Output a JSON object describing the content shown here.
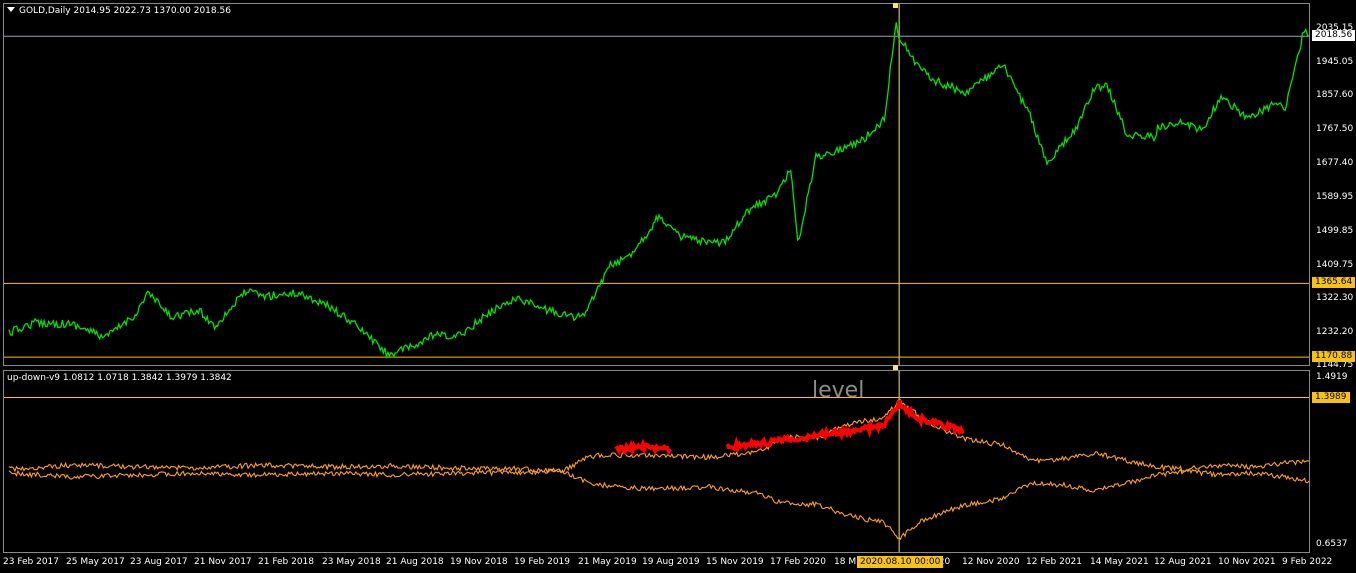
{
  "chart_data": [
    {
      "type": "line",
      "title": "GOLD,Daily  2014.95 2022.73 1370.00 2018.56",
      "symbol": "GOLD",
      "timeframe": "Daily",
      "ohlc": {
        "open": 2014.95,
        "high": 2022.73,
        "low": 1370.0,
        "close": 2018.56
      },
      "y_ticks": [
        "2035.15",
        "1945.05",
        "1857.60",
        "1767.50",
        "1677.40",
        "1589.95",
        "1499.85",
        "1409.75",
        "1322.30",
        "1232.20",
        "1144.75"
      ],
      "ylim": [
        1144.75,
        2035.15
      ],
      "x_ticks": [
        "23 Feb 2017",
        "25 May 2017",
        "23 Aug 2017",
        "21 Nov 2017",
        "21 Feb 2018",
        "23 May 2018",
        "21 Aug 2018",
        "19 Nov 2018",
        "19 Feb 2019",
        "21 May 2019",
        "19 Aug 2019",
        "15 Nov 2019",
        "17 Feb 2020",
        "18 M",
        "2020.08.10 00:00",
        "020",
        "12 Nov 2020",
        "12 Feb 2021",
        "14 May 2021",
        "12 Aug 2021",
        "10 Nov 2021",
        "9 Feb 2022"
      ],
      "horizontal_lines": [
        {
          "value": 2018.56,
          "label": "2018.56",
          "color": "#9aa0b8"
        },
        {
          "value": 1365.64,
          "label": "1365.64",
          "color": "#f7c30f"
        },
        {
          "value": 1170.88,
          "label": "1170.88",
          "color": "#f7c30f"
        }
      ],
      "crosshair_time": "2020.08.10 00:00",
      "series": [
        {
          "color": "#00e400",
          "x": [
            "2017-02-23",
            "2017-04-01",
            "2017-05-25",
            "2017-07-10",
            "2017-08-23",
            "2017-09-08",
            "2017-10-10",
            "2017-11-21",
            "2017-12-12",
            "2018-01-25",
            "2018-02-21",
            "2018-04-11",
            "2018-05-23",
            "2018-07-01",
            "2018-08-15",
            "2018-09-20",
            "2018-10-20",
            "2018-11-19",
            "2019-01-01",
            "2019-01-31",
            "2019-02-19",
            "2019-03-20",
            "2019-05-02",
            "2019-05-21",
            "2019-06-25",
            "2019-07-20",
            "2019-08-19",
            "2019-09-04",
            "2019-10-01",
            "2019-11-15",
            "2019-12-05",
            "2020-01-08",
            "2020-02-17",
            "2020-03-09",
            "2020-03-19",
            "2020-04-14",
            "2020-05-18",
            "2020-06-20",
            "2020-07-20",
            "2020-08-06",
            "2020-08-10",
            "2020-09-01",
            "2020-10-01",
            "2020-11-12",
            "2021-01-05",
            "2021-02-12",
            "2021-03-08",
            "2021-04-20",
            "2021-05-14",
            "2021-06-01",
            "2021-06-29",
            "2021-08-09",
            "2021-08-12",
            "2021-09-20",
            "2021-10-15",
            "2021-11-10",
            "2021-11-16",
            "2021-12-20",
            "2022-01-25",
            "2022-02-09",
            "2022-03-01",
            "2022-03-08",
            "2022-03-15"
          ],
          "y": [
            1235,
            1262,
            1258,
            1222,
            1286,
            1342,
            1278,
            1292,
            1252,
            1345,
            1332,
            1340,
            1305,
            1255,
            1178,
            1198,
            1230,
            1222,
            1280,
            1318,
            1325,
            1300,
            1278,
            1280,
            1410,
            1432,
            1500,
            1545,
            1492,
            1470,
            1475,
            1558,
            1600,
            1670,
            1470,
            1700,
            1720,
            1745,
            1800,
            2060,
            2020,
            1950,
            1900,
            1870,
            1940,
            1810,
            1680,
            1780,
            1880,
            1890,
            1760,
            1750,
            1780,
            1790,
            1770,
            1860,
            1850,
            1800,
            1840,
            1830,
            1980,
            2035,
            2018
          ]
        }
      ]
    },
    {
      "type": "line",
      "title": "up-down-v9 1.0812 1.0718 1.3842 1.3979 1.3842",
      "indicator": "up-down-v9",
      "values_text": "1.0812 1.0718 1.3842 1.3979 1.3842",
      "y_ticks": [
        "1.4919",
        "0.6537"
      ],
      "ylim": [
        0.6537,
        1.4919
      ],
      "horizontal_lines": [
        {
          "value": 1.3989,
          "label": "1.3989",
          "color": "#f7c30f"
        }
      ],
      "annotation": "level",
      "series": [
        {
          "color": "#ffa01e",
          "x": [
            "2017-02-23",
            "2017-05-25",
            "2017-08-23",
            "2017-11-21",
            "2018-02-21",
            "2018-05-23",
            "2018-08-21",
            "2018-11-19",
            "2019-02-19",
            "2019-04-20",
            "2019-05-21",
            "2019-06-10",
            "2019-08-19",
            "2019-11-15",
            "2020-01-20",
            "2020-02-17",
            "2020-03-09",
            "2020-04-20",
            "2020-05-18",
            "2020-06-20",
            "2020-07-20",
            "2020-08-10",
            "2020-09-10",
            "2020-10-10",
            "2020-11-12",
            "2021-01-05",
            "2021-02-12",
            "2021-04-01",
            "2021-05-14",
            "2021-07-01",
            "2021-08-12",
            "2021-09-20",
            "2021-11-10",
            "2021-12-20",
            "2022-02-09",
            "2022-03-15"
          ],
          "y": [
            1.04,
            1.06,
            1.05,
            1.045,
            1.06,
            1.05,
            1.055,
            1.045,
            1.04,
            1.03,
            1.09,
            1.11,
            1.11,
            1.1,
            1.12,
            1.17,
            1.2,
            1.2,
            1.25,
            1.28,
            1.3,
            1.38,
            1.3,
            1.24,
            1.19,
            1.16,
            1.08,
            1.09,
            1.12,
            1.08,
            1.05,
            1.04,
            1.06,
            1.05,
            1.07,
            1.08
          ]
        },
        {
          "color": "#ffa01e",
          "x": [
            "2017-02-23",
            "2017-05-25",
            "2017-08-23",
            "2017-11-21",
            "2018-02-21",
            "2018-05-23",
            "2018-08-21",
            "2018-11-19",
            "2019-02-19",
            "2019-04-20",
            "2019-05-21",
            "2019-06-10",
            "2019-08-19",
            "2019-11-15",
            "2020-01-20",
            "2020-02-17",
            "2020-03-09",
            "2020-04-20",
            "2020-05-18",
            "2020-06-20",
            "2020-07-20",
            "2020-08-10",
            "2020-09-10",
            "2020-10-10",
            "2020-11-12",
            "2021-01-05",
            "2021-02-12",
            "2021-04-01",
            "2021-05-14",
            "2021-07-01",
            "2021-08-12",
            "2021-09-20",
            "2021-11-10",
            "2021-12-20",
            "2022-02-09",
            "2022-03-15"
          ],
          "y": [
            1.02,
            1.0,
            1.01,
            1.02,
            1.01,
            1.02,
            1.01,
            1.02,
            1.02,
            1.03,
            0.98,
            0.96,
            0.94,
            0.95,
            0.92,
            0.88,
            0.87,
            0.86,
            0.82,
            0.79,
            0.77,
            0.69,
            0.78,
            0.82,
            0.86,
            0.89,
            0.97,
            0.96,
            0.93,
            0.97,
            1.01,
            1.03,
            1.01,
            1.02,
            1.0,
            0.98
          ]
        },
        {
          "color": "#ff0000",
          "segments": [
            {
              "x": [
                "2019-07-05",
                "2019-08-10",
                "2019-09-20"
              ],
              "y": [
                1.14,
                1.15,
                1.14
              ]
            },
            {
              "x": [
                "2019-12-10",
                "2020-01-20",
                "2020-02-17",
                "2020-03-19",
                "2020-05-01",
                "2020-06-10",
                "2020-07-20",
                "2020-08-10",
                "2020-09-10",
                "2020-10-20",
                "2020-11-10"
              ],
              "y": [
                1.15,
                1.17,
                1.18,
                1.19,
                1.22,
                1.23,
                1.26,
                1.37,
                1.29,
                1.25,
                1.23
              ]
            }
          ]
        }
      ]
    }
  ],
  "colors": {
    "background": "#000000",
    "price": "#00e400",
    "indicator": "#ffa01e",
    "highlight": "#ff0000",
    "level": "#f7c30f",
    "grid_line": "#9aa0b8"
  }
}
